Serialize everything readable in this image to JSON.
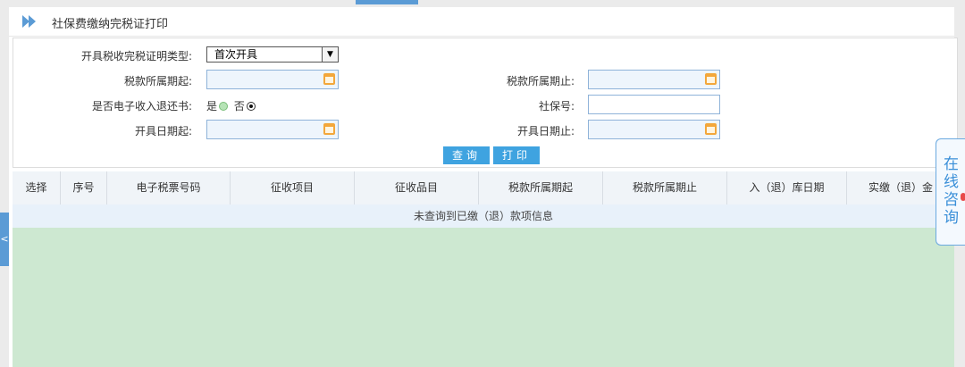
{
  "page": {
    "title": "社保费缴纳完税证打印"
  },
  "form": {
    "cert_type_label": "开具税收完税证明类型:",
    "cert_type_value": "首次开具",
    "tax_period_start_label": "税款所属期起:",
    "tax_period_start_value": "",
    "tax_period_end_label": "税款所属期止:",
    "tax_period_end_value": "",
    "e_refund_label": "是否电子收入退还书:",
    "e_refund_yes": "是",
    "e_refund_no": "否",
    "e_refund_selected": "否",
    "social_security_no_label": "社保号:",
    "social_security_no_value": "",
    "issue_date_start_label": "开具日期起:",
    "issue_date_start_value": "",
    "issue_date_end_label": "开具日期止:",
    "issue_date_end_value": "",
    "query_button": "查询",
    "print_button": "打印"
  },
  "table": {
    "columns": [
      "选择",
      "序号",
      "电子税票号码",
      "征收项目",
      "征收品目",
      "税款所属期起",
      "税款所属期止",
      "入（退）库日期",
      "实缴（退）金"
    ],
    "empty_message": "未查询到已缴（退）款项信息"
  },
  "consult": {
    "label": "在线咨询"
  },
  "sidebar": {
    "toggle_label": "<"
  },
  "colors": {
    "accent": "#3fa3e0",
    "grid_background": "#cde8d1",
    "header_background": "#f0f4f8"
  }
}
